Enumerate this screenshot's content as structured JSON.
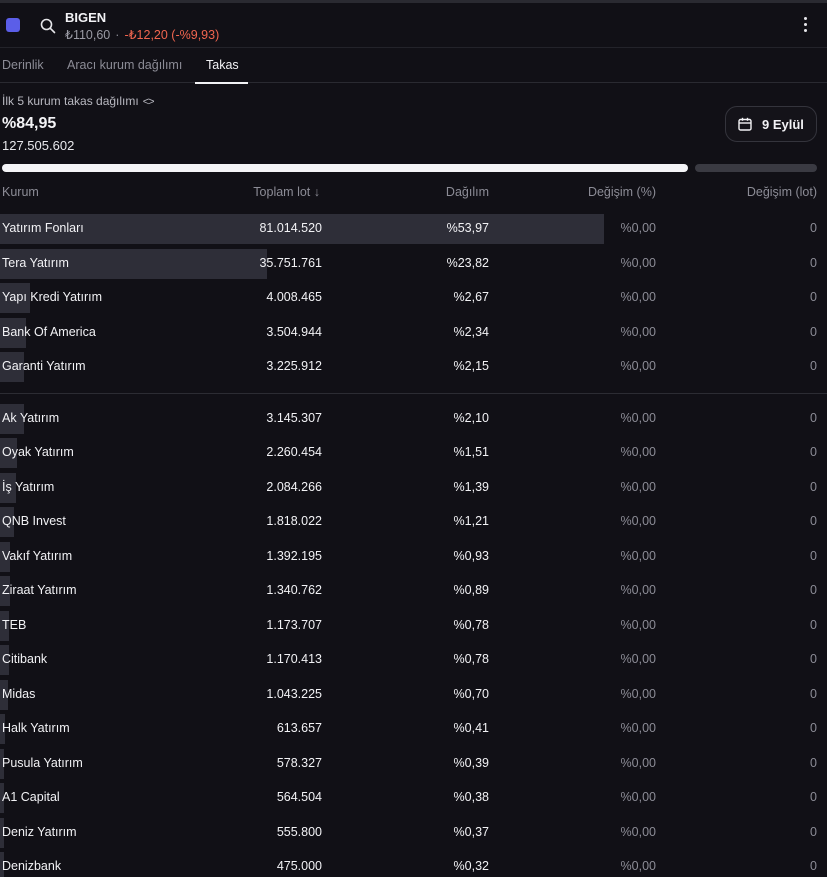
{
  "header": {
    "ticker": "BIGEN",
    "price": "₺110,60",
    "separator": "·",
    "change": "-₺12,20 (-%9,93)"
  },
  "tabs": [
    {
      "label": "Derinlik",
      "active": false
    },
    {
      "label": "Aracı kurum dağılımı",
      "active": false
    },
    {
      "label": "Takas",
      "active": true
    }
  ],
  "summary": {
    "title": "İlk 5 kurum takas dağılımı",
    "code_icon": "<>",
    "percent": "%84,95",
    "total": "127.505.602",
    "date_label": "9 Eylül",
    "share": 0.8495
  },
  "columns": {
    "kurum": "Kurum",
    "toplam_lot": "Toplam lot ↓",
    "dagilim": "Dağılım",
    "degisim_pct": "Değişim (%)",
    "degisim_lot": "Değişim (lot)"
  },
  "rows": [
    {
      "name": "Yatırım Fonları",
      "lot": "81.014.520",
      "pct": "%53,97",
      "chg": "%0,00",
      "chglot": "0",
      "share": 53.97
    },
    {
      "name": "Tera Yatırım",
      "lot": "35.751.761",
      "pct": "%23,82",
      "chg": "%0,00",
      "chglot": "0",
      "share": 23.82
    },
    {
      "name": "Yapı Kredi Yatırım",
      "lot": "4.008.465",
      "pct": "%2,67",
      "chg": "%0,00",
      "chglot": "0",
      "share": 2.67
    },
    {
      "name": "Bank Of America",
      "lot": "3.504.944",
      "pct": "%2,34",
      "chg": "%0,00",
      "chglot": "0",
      "share": 2.34
    },
    {
      "name": "Garanti Yatırım",
      "lot": "3.225.912",
      "pct": "%2,15",
      "chg": "%0,00",
      "chglot": "0",
      "share": 2.15
    },
    {
      "name": "Ak Yatırım",
      "lot": "3.145.307",
      "pct": "%2,10",
      "chg": "%0,00",
      "chglot": "0",
      "share": 2.1
    },
    {
      "name": "Oyak Yatırım",
      "lot": "2.260.454",
      "pct": "%1,51",
      "chg": "%0,00",
      "chglot": "0",
      "share": 1.51
    },
    {
      "name": "İş Yatırım",
      "lot": "2.084.266",
      "pct": "%1,39",
      "chg": "%0,00",
      "chglot": "0",
      "share": 1.39
    },
    {
      "name": "QNB Invest",
      "lot": "1.818.022",
      "pct": "%1,21",
      "chg": "%0,00",
      "chglot": "0",
      "share": 1.21
    },
    {
      "name": "Vakıf Yatırım",
      "lot": "1.392.195",
      "pct": "%0,93",
      "chg": "%0,00",
      "chglot": "0",
      "share": 0.93
    },
    {
      "name": "Ziraat Yatırım",
      "lot": "1.340.762",
      "pct": "%0,89",
      "chg": "%0,00",
      "chglot": "0",
      "share": 0.89
    },
    {
      "name": "TEB",
      "lot": "1.173.707",
      "pct": "%0,78",
      "chg": "%0,00",
      "chglot": "0",
      "share": 0.78
    },
    {
      "name": "Citibank",
      "lot": "1.170.413",
      "pct": "%0,78",
      "chg": "%0,00",
      "chglot": "0",
      "share": 0.78
    },
    {
      "name": "Midas",
      "lot": "1.043.225",
      "pct": "%0,70",
      "chg": "%0,00",
      "chglot": "0",
      "share": 0.7
    },
    {
      "name": "Halk Yatırım",
      "lot": "613.657",
      "pct": "%0,41",
      "chg": "%0,00",
      "chglot": "0",
      "share": 0.41
    },
    {
      "name": "Pusula Yatırım",
      "lot": "578.327",
      "pct": "%0,39",
      "chg": "%0,00",
      "chglot": "0",
      "share": 0.39
    },
    {
      "name": "A1 Capital",
      "lot": "564.504",
      "pct": "%0,38",
      "chg": "%0,00",
      "chglot": "0",
      "share": 0.38
    },
    {
      "name": "Deniz Yatırım",
      "lot": "555.800",
      "pct": "%0,37",
      "chg": "%0,00",
      "chglot": "0",
      "share": 0.37
    },
    {
      "name": "Denizbank",
      "lot": "475.000",
      "pct": "%0,32",
      "chg": "%0,00",
      "chglot": "0",
      "share": 0.32
    }
  ],
  "colors": {
    "background": "#111016",
    "accent": "#5b5ee8",
    "negative": "#f0654f",
    "bar": "#2e2e38"
  },
  "icons": [
    "square-icon",
    "search-icon",
    "more-vertical-icon",
    "code-icon",
    "calendar-icon"
  ]
}
